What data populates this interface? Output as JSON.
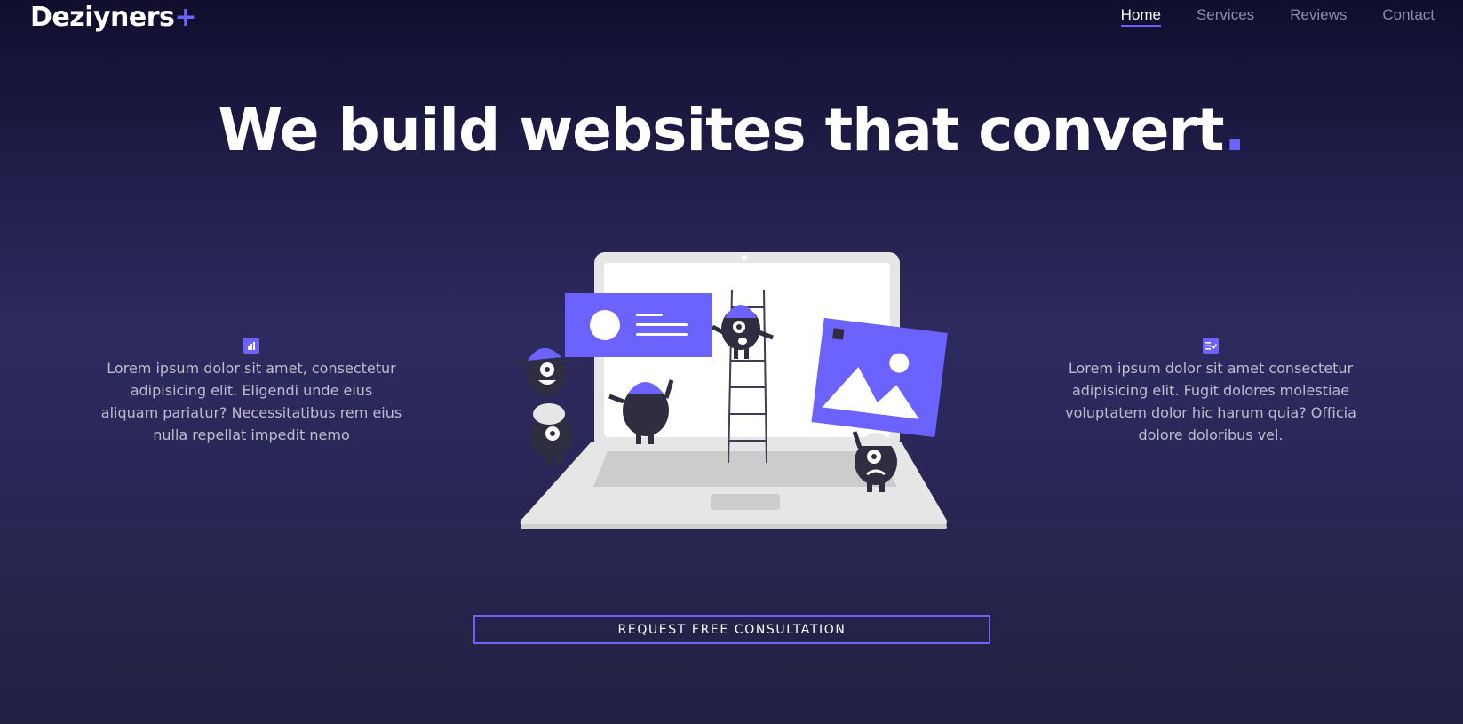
{
  "brand": {
    "name": "Deziyners",
    "plus": "+",
    "accent": "#6c63ff"
  },
  "nav": {
    "items": [
      {
        "label": "Home",
        "active": true
      },
      {
        "label": "Services"
      },
      {
        "label": "Reviews"
      },
      {
        "label": "Contact"
      }
    ]
  },
  "hero": {
    "headline": "We build websites that convert",
    "headline_dot": "."
  },
  "features": {
    "left": {
      "icon": "bar-chart-icon",
      "text": "Lorem ipsum dolor sit amet, consectetur adipisicing elit. Eligendi unde eius aliquam pariatur? Necessitatibus rem eius nulla repellat impedit nemo"
    },
    "right": {
      "icon": "checklist-icon",
      "text": "Lorem ipsum dolor sit amet consectetur adipisicing elit. Fugit dolores molestiae voluptatem dolor hic harum quia? Officia dolore doloribus vel."
    }
  },
  "cta": {
    "label": "REQUEST FREE CONSULTATION"
  }
}
